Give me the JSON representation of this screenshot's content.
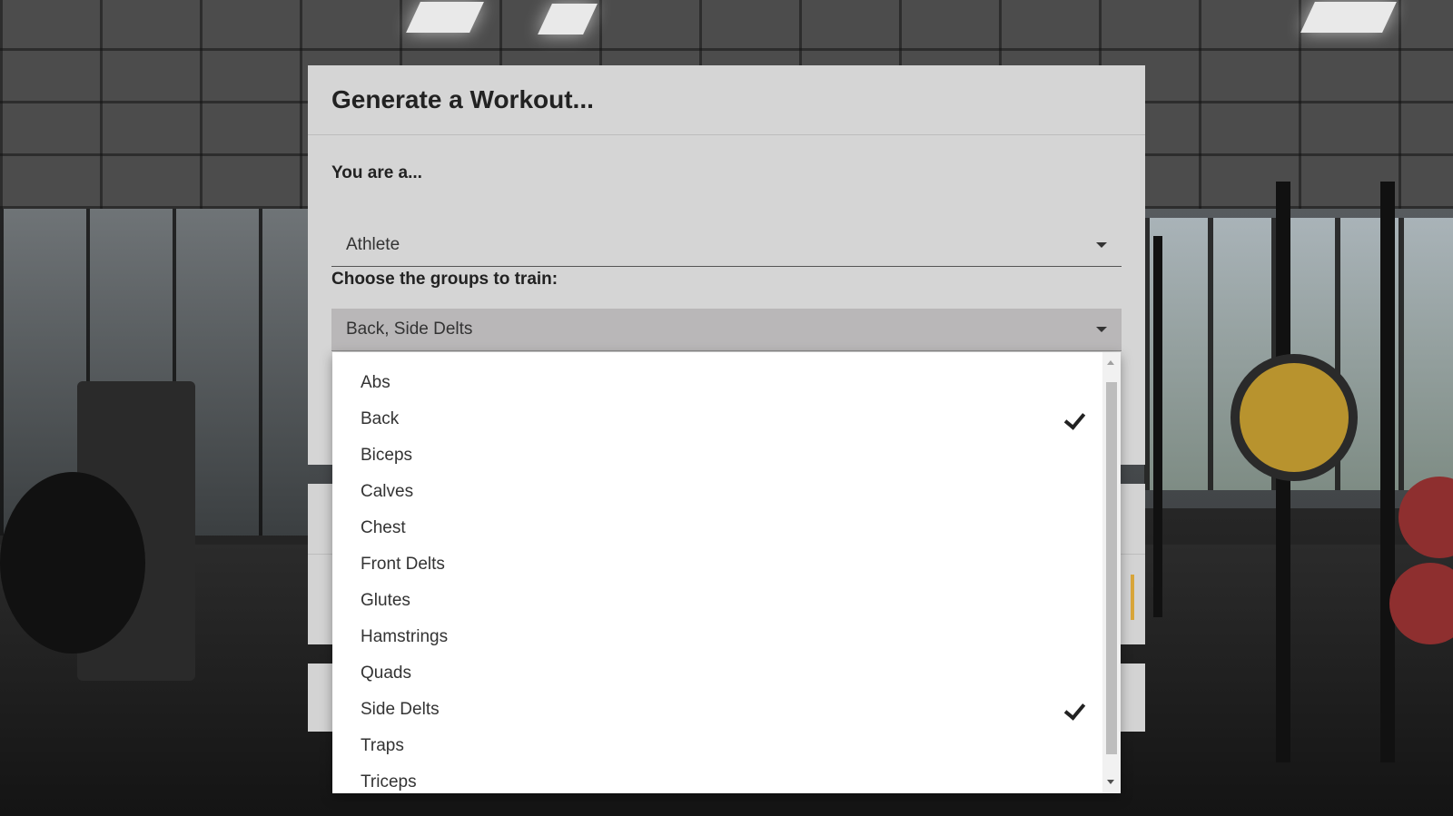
{
  "card": {
    "title": "Generate a Workout..."
  },
  "role": {
    "label": "You are a...",
    "value": "Athlete"
  },
  "groups": {
    "label": "Choose the groups to train:",
    "value": "Back, Side Delts"
  },
  "dropdown": {
    "options": [
      {
        "label": "Abs",
        "checked": false
      },
      {
        "label": "Back",
        "checked": true
      },
      {
        "label": "Biceps",
        "checked": false
      },
      {
        "label": "Calves",
        "checked": false
      },
      {
        "label": "Chest",
        "checked": false
      },
      {
        "label": "Front Delts",
        "checked": false
      },
      {
        "label": "Glutes",
        "checked": false
      },
      {
        "label": "Hamstrings",
        "checked": false
      },
      {
        "label": "Quads",
        "checked": false
      },
      {
        "label": "Side Delts",
        "checked": true
      },
      {
        "label": "Traps",
        "checked": false
      },
      {
        "label": "Triceps",
        "checked": false
      }
    ]
  },
  "colors": {
    "card": "#d5d5d5",
    "selected_field": "#b9b7b8",
    "accent": "#d9a63b"
  }
}
